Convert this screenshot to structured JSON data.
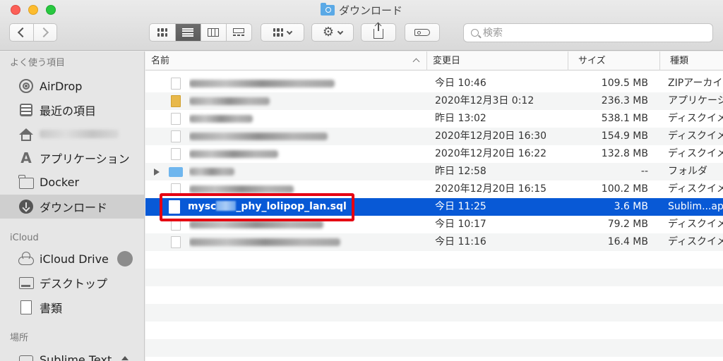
{
  "window": {
    "title": "ダウンロード"
  },
  "toolbar": {
    "search_placeholder": "検索",
    "group_icon": "grid-icon",
    "action_icon": "gear-icon",
    "share_icon": "share-icon",
    "tag_icon": "tag-icon"
  },
  "sidebar": {
    "favorites_header": "よく使う項目",
    "favorites": [
      {
        "label": "AirDrop",
        "icon": "airdrop-icon"
      },
      {
        "label": "最近の項目",
        "icon": "recents-icon"
      },
      {
        "label": "",
        "icon": "home-icon"
      },
      {
        "label": "アプリケーション",
        "icon": "applications-icon"
      },
      {
        "label": "Docker",
        "icon": "folder-icon"
      },
      {
        "label": "ダウンロード",
        "icon": "downloads-icon"
      }
    ],
    "icloud_header": "iCloud",
    "icloud": [
      {
        "label": "iCloud Drive",
        "icon": "cloud-icon"
      },
      {
        "label": "デスクトップ",
        "icon": "desktop-icon"
      },
      {
        "label": "書類",
        "icon": "documents-icon"
      }
    ],
    "locations_header": "場所",
    "locations": [
      {
        "label": "Sublime Text",
        "icon": "disk-icon"
      }
    ]
  },
  "columns": {
    "name": "名前",
    "date": "変更日",
    "size": "サイズ",
    "kind": "種類"
  },
  "files": [
    {
      "name": "",
      "date": "今日 10:46",
      "size": "109.5 MB",
      "kind": "ZIPアーカイブ"
    },
    {
      "name": "",
      "date": "2020年12月3日 0:12",
      "size": "236.3 MB",
      "kind": "アプリケーション"
    },
    {
      "name": "",
      "date": "昨日 13:02",
      "size": "538.1 MB",
      "kind": "ディスクイメージ"
    },
    {
      "name": "",
      "date": "2020年12月20日 16:30",
      "size": "154.9 MB",
      "kind": "ディスクイメージ"
    },
    {
      "name": "",
      "date": "2020年12月20日 16:22",
      "size": "132.8 MB",
      "kind": "ディスクイメージ"
    },
    {
      "name": "",
      "date": "昨日 12:58",
      "size": "--",
      "kind": "フォルダ"
    },
    {
      "name": "",
      "date": "2020年12月20日 16:15",
      "size": "100.2 MB",
      "kind": "ディスクイメージ"
    },
    {
      "name_prefix": "mysc",
      "name_suffix": "_phy_lolipop_lan.sql",
      "date": "今日 11:25",
      "size": "3.6 MB",
      "kind": "Sublim...app"
    },
    {
      "name": "",
      "date": "今日 10:17",
      "size": "79.2 MB",
      "kind": "ディスクイメージ"
    },
    {
      "name": "",
      "date": "今日 11:16",
      "size": "16.4 MB",
      "kind": "ディスクイメージ"
    }
  ],
  "colors": {
    "selection": "#0859d6",
    "highlight_box": "#e50012",
    "folder_accent": "#5aa9e6"
  }
}
